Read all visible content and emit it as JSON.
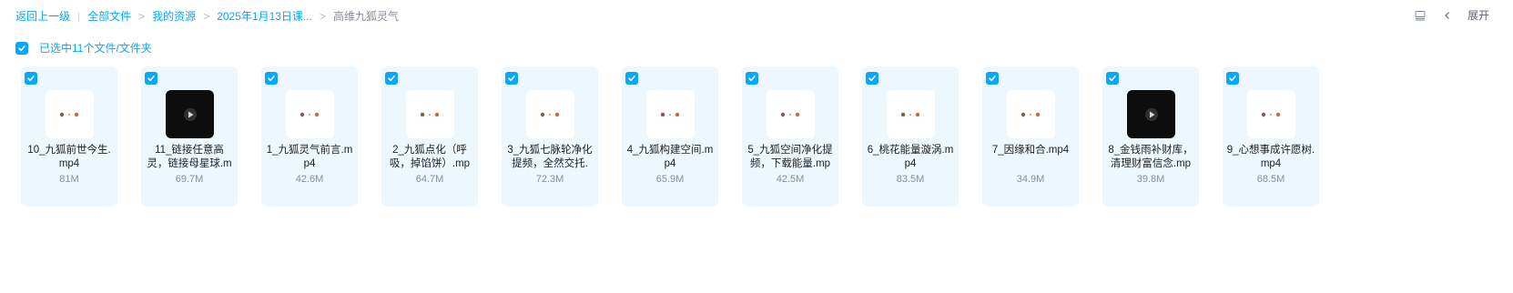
{
  "breadcrumb": {
    "back": "返回上一级",
    "items": [
      "全部文件",
      "我的资源",
      "2025年1月13日课..."
    ],
    "current": "高维九狐灵气"
  },
  "toolbar": {
    "view_icon": "list-view-icon",
    "collapse_icon": "chevron-left-icon",
    "expand_label": "展开"
  },
  "selection": {
    "label": "已选中11个文件/文件夹",
    "checked": true
  },
  "files": [
    {
      "name": "10_九狐前世今生.mp4",
      "size": "81M",
      "thumb": "video-frame",
      "checked": true
    },
    {
      "name": "11_链接任意高灵，链接母星球.m",
      "size": "69.7M",
      "thumb": "play",
      "checked": true
    },
    {
      "name": "1_九狐灵气前言.mp4",
      "size": "42.6M",
      "thumb": "video-frame",
      "checked": true
    },
    {
      "name": "2_九狐点化（呼吸，掉馅饼）.mp",
      "size": "64.7M",
      "thumb": "video-frame",
      "checked": true
    },
    {
      "name": "3_九狐七脉轮净化提频，全然交托.",
      "size": "72.3M",
      "thumb": "video-frame",
      "checked": true
    },
    {
      "name": "4_九狐构建空间.mp4",
      "size": "65.9M",
      "thumb": "video-frame",
      "checked": true
    },
    {
      "name": "5_九狐空间净化提频，下载能量.mp",
      "size": "42.5M",
      "thumb": "video-frame",
      "checked": true
    },
    {
      "name": "6_桃花能量漩涡.mp4",
      "size": "83.5M",
      "thumb": "video-frame",
      "checked": true
    },
    {
      "name": "7_因缘和合.mp4",
      "size": "34.9M",
      "thumb": "video-frame",
      "checked": true
    },
    {
      "name": "8_金钱雨补财库，清理财富信念.mp",
      "size": "39.8M",
      "thumb": "play",
      "checked": true
    },
    {
      "name": "9_心想事成许愿树.mp4",
      "size": "68.5M",
      "thumb": "video-frame",
      "checked": true
    }
  ],
  "colors": {
    "accent": "#06a7ff",
    "card_bg": "#eef7fe",
    "muted": "#878c9c"
  }
}
